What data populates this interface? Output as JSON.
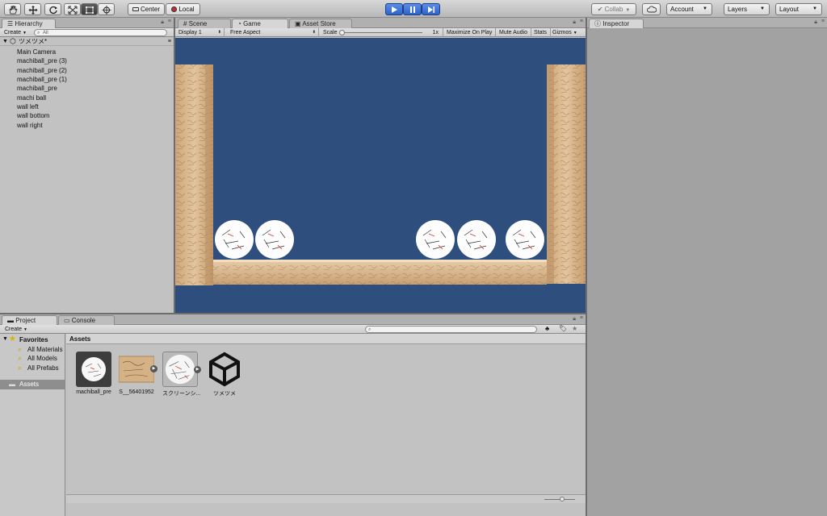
{
  "toolbar": {
    "center_label": "Center",
    "local_label": "Local",
    "collab_label": "Collab",
    "account_label": "Account",
    "layers_label": "Layers",
    "layout_label": "Layout"
  },
  "hierarchy": {
    "tab_label": "Hierarchy",
    "create_label": "Create",
    "search_placeholder": "All",
    "scene_name": "ツメツメ*",
    "items": [
      "Main Camera",
      "machiball_pre (3)",
      "machiball_pre (2)",
      "machiball_pre (1)",
      "machiball_pre",
      "machi ball",
      "wall left",
      "wall bottom",
      "wall right"
    ]
  },
  "center_tabs": {
    "scene_label": "Scene",
    "game_label": "Game",
    "asset_store_label": "Asset Store"
  },
  "game_bar": {
    "display_label": "Display 1",
    "aspect_label": "Free Aspect",
    "scale_label": "Scale",
    "scale_value": "1x",
    "maximize_label": "Maximize On Play",
    "mute_label": "Mute Audio",
    "stats_label": "Stats",
    "gizmos_label": "Gizmos"
  },
  "inspector": {
    "tab_label": "Inspector"
  },
  "project": {
    "project_tab_label": "Project",
    "console_tab_label": "Console",
    "create_label": "Create",
    "favorites_label": "Favorites",
    "favorites": [
      "All Materials",
      "All Models",
      "All Prefabs"
    ],
    "assets_folder_label": "Assets",
    "breadcrumb": "Assets",
    "assets": [
      {
        "name": "machiball_pre"
      },
      {
        "name": "S__56401952"
      },
      {
        "name": "スクリーンシ..."
      },
      {
        "name": "ツメツメ"
      }
    ]
  },
  "colors": {
    "game_background": "#2e4e7d",
    "play_accent": "#3b72d9",
    "wall_tone": "#d9b88e"
  }
}
